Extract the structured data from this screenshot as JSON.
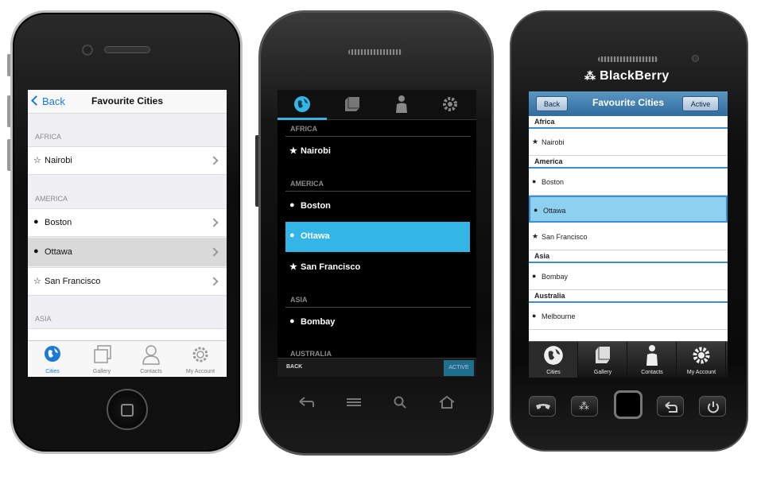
{
  "iphone": {
    "nav": {
      "back_label": "Back",
      "title": "Favourite Cities"
    },
    "sections": [
      {
        "label": "AFRICA",
        "items": [
          {
            "label": "Nairobi",
            "icon": "star-icon"
          }
        ]
      },
      {
        "label": "AMERICA",
        "items": [
          {
            "label": "Boston",
            "icon": "globe-icon"
          },
          {
            "label": "Ottawa",
            "icon": "globe-icon",
            "selected": true
          },
          {
            "label": "San Francisco",
            "icon": "star-icon"
          }
        ]
      },
      {
        "label": "ASIA",
        "items": []
      }
    ],
    "tabs": [
      {
        "label": "Cities",
        "icon": "globe-icon",
        "active": true
      },
      {
        "label": "Gallery",
        "icon": "gallery-icon"
      },
      {
        "label": "Contacts",
        "icon": "person-icon"
      },
      {
        "label": "My Account",
        "icon": "gear-icon"
      }
    ]
  },
  "android": {
    "tabs": [
      {
        "icon": "globe-icon",
        "active": true
      },
      {
        "icon": "gallery-icon"
      },
      {
        "icon": "person-icon"
      },
      {
        "icon": "gear-icon"
      }
    ],
    "sections": [
      {
        "label": "AFRICA",
        "items": [
          {
            "label": "Nairobi",
            "icon": "star-icon"
          }
        ]
      },
      {
        "label": "AMERICA",
        "items": [
          {
            "label": "Boston",
            "icon": "globe-icon"
          },
          {
            "label": "Ottawa",
            "icon": "globe-icon",
            "selected": true
          },
          {
            "label": "San Francisco",
            "icon": "star-icon"
          }
        ]
      },
      {
        "label": "ASIA",
        "items": [
          {
            "label": "Bombay",
            "icon": "globe-icon"
          }
        ]
      },
      {
        "label": "AUSTRALIA",
        "items": []
      }
    ],
    "bottom": {
      "back_label": "BACK",
      "active_label": "ACTIVE"
    },
    "accent": "#33b5e5"
  },
  "blackberry": {
    "brand": "BlackBerry",
    "header": {
      "back_label": "Back",
      "title": "Favourite Cities",
      "active_label": "Active"
    },
    "sections": [
      {
        "label": "Africa",
        "items": [
          {
            "label": "Nairobi",
            "icon": "star-icon"
          }
        ]
      },
      {
        "label": "America",
        "items": [
          {
            "label": "Boston",
            "icon": "globe-icon"
          },
          {
            "label": "Ottawa",
            "icon": "globe-icon",
            "selected": true
          },
          {
            "label": "San Francisco",
            "icon": "star-icon"
          }
        ]
      },
      {
        "label": "Asia",
        "items": [
          {
            "label": "Bombay",
            "icon": "globe-icon"
          }
        ]
      },
      {
        "label": "Australia",
        "items": [
          {
            "label": "Melbourne",
            "icon": "globe-icon"
          }
        ]
      }
    ],
    "tabs": [
      {
        "label": "Cities",
        "icon": "globe-icon",
        "active": true
      },
      {
        "label": "Gallery",
        "icon": "gallery-icon"
      },
      {
        "label": "Contacts",
        "icon": "person-icon"
      },
      {
        "label": "My Account",
        "icon": "gear-icon"
      }
    ],
    "accent": "#3a8fd0"
  }
}
